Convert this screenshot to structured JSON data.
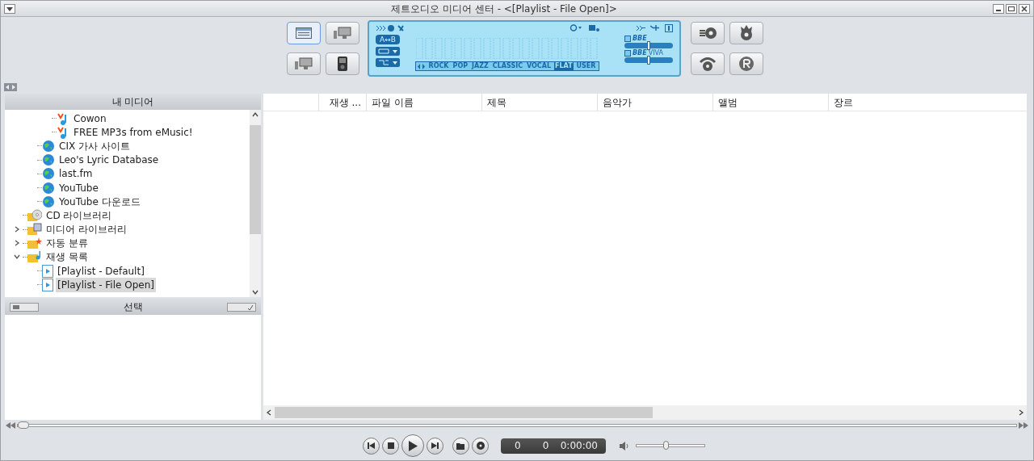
{
  "window": {
    "title": "제트오디오 미디어 센터 - <[Playlist - File Open]>"
  },
  "view_buttons": [
    {
      "kind": "window",
      "selected": true
    },
    {
      "kind": "monitor",
      "selected": false
    },
    {
      "kind": "monitor",
      "selected": false
    },
    {
      "kind": "player",
      "selected": false
    }
  ],
  "display": {
    "ab_label": "A↔B",
    "eq_presets": [
      {
        "label": "ROCK",
        "selected": false
      },
      {
        "label": "POP",
        "selected": false
      },
      {
        "label": "JAZZ",
        "selected": false
      },
      {
        "label": "CLASSIC",
        "selected": false
      },
      {
        "label": "VOCAL",
        "selected": false
      },
      {
        "label": "FLAT",
        "selected": true
      },
      {
        "label": "USER",
        "selected": false
      }
    ],
    "bbe": {
      "label": "BBE",
      "checked": false,
      "level": 0.5
    },
    "bbe_viva": {
      "label": "BBE",
      "suffix": "VIVA",
      "checked": false,
      "level": 0.5
    }
  },
  "sidebar": {
    "header": "내 미디어",
    "tree": [
      {
        "children": [
          {
            "children": [
              {
                "label": "Cowon",
                "kind": "music"
              },
              {
                "label": "FREE MP3s from eMusic!",
                "kind": "music"
              }
            ]
          },
          {
            "label": "CIX 가사 사이트",
            "kind": "globe"
          },
          {
            "label": "Leo's Lyric Database",
            "kind": "globe"
          },
          {
            "label": "last.fm",
            "kind": "globe"
          },
          {
            "label": "YouTube",
            "kind": "globe"
          },
          {
            "label": "YouTube 다운로드",
            "kind": "globe"
          }
        ]
      },
      {
        "label": "CD 라이브러리",
        "kind": "cd"
      },
      {
        "label": "미디어 라이브러리",
        "kind": "library",
        "expanded": false
      },
      {
        "label": "자동 분류",
        "kind": "auto",
        "expanded": false
      },
      {
        "label": "재생 목록",
        "kind": "playlist",
        "expanded": true,
        "children": [
          {
            "label": "[Playlist - Default]",
            "kind": "file",
            "selected": false
          },
          {
            "label": "[Playlist - File Open]",
            "kind": "file",
            "selected": true
          }
        ]
      }
    ],
    "selection_header": "선택"
  },
  "table": {
    "columns": [
      "재생 ...",
      "파일 이름",
      "제목",
      "음악가",
      "앨범",
      "장르"
    ]
  },
  "player": {
    "seek": {
      "level": 0
    },
    "counter": [
      "0",
      "0",
      "0:00:00"
    ],
    "volume": {
      "level": 0.42
    }
  }
}
